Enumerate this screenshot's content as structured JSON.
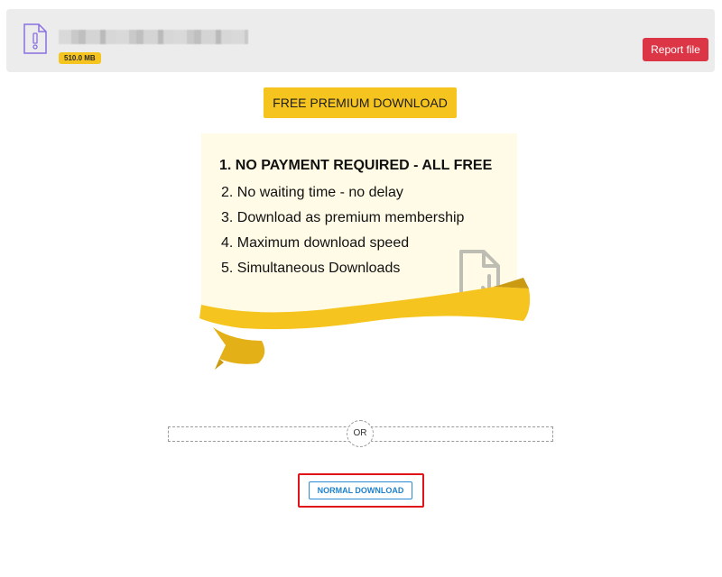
{
  "file": {
    "size_label": "510.0 MB",
    "icon": "file-warning-icon"
  },
  "header": {
    "report_label": "Report file",
    "report_color": "#dc3545"
  },
  "premium": {
    "button_label": "FREE PREMIUM DOWNLOAD",
    "button_color": "#f6c41f",
    "title": "1. NO PAYMENT REQUIRED - ALL FREE",
    "items": [
      "2. No waiting time - no delay",
      "3. Download as premium membership",
      "4. Maximum download speed",
      "5. Simultaneous Downloads"
    ],
    "icon": "file-download-icon"
  },
  "divider": {
    "label": "OR"
  },
  "normal": {
    "button_label": "NORMAL DOWNLOAD",
    "accent": "#1f82cc",
    "highlight_color": "#e0121a"
  }
}
